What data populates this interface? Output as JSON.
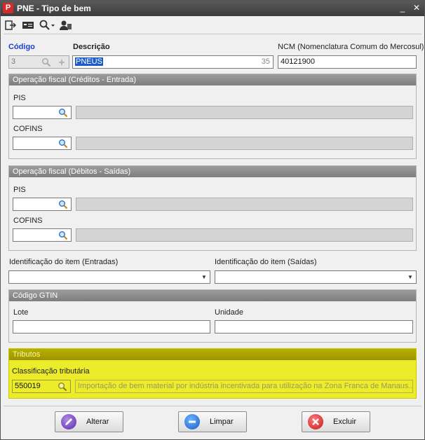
{
  "window": {
    "title": "PNE - Tipo de bem",
    "minimize": "_",
    "close": "✕"
  },
  "colors": {
    "highlight": "#ecec2a",
    "selection": "#1e5ac8",
    "codigo_label": "#1a3fd1"
  },
  "toolbar": {
    "icons": [
      "exit-icon",
      "card-icon",
      "search-dropdown-icon",
      "user-icon"
    ]
  },
  "form": {
    "codigo_label": "Código",
    "codigo_value": "3",
    "descricao_label": "Descrição",
    "descricao_value": "PNEUS",
    "descricao_maxlen": "35",
    "ncm_label": "NCM (Nomenclatura Comum do Mercosul)",
    "ncm_value": "40121900"
  },
  "op_entrada": {
    "header": "Operação fiscal (Créditos - Entrada)",
    "pis_label": "PIS",
    "cofins_label": "COFINS"
  },
  "op_saida": {
    "header": "Operação fiscal (Débitos - Saídas)",
    "pis_label": "PIS",
    "cofins_label": "COFINS"
  },
  "ident": {
    "entradas_label": "Identificação do item (Entradas)",
    "saidas_label": "Identificação do item (Saídas)"
  },
  "gtin": {
    "header": "Código GTIN",
    "lote_label": "Lote",
    "unidade_label": "Unidade"
  },
  "tributos": {
    "header": "Tributos",
    "classificacao_label": "Classificação tributária",
    "code_value": "550019",
    "description": "Importação de bem material por indústria incentivada para utilização na Zona Franca de Manaus..."
  },
  "buttons": {
    "alterar": "Alterar",
    "limpar": "Limpar",
    "excluir": "Excluir"
  }
}
